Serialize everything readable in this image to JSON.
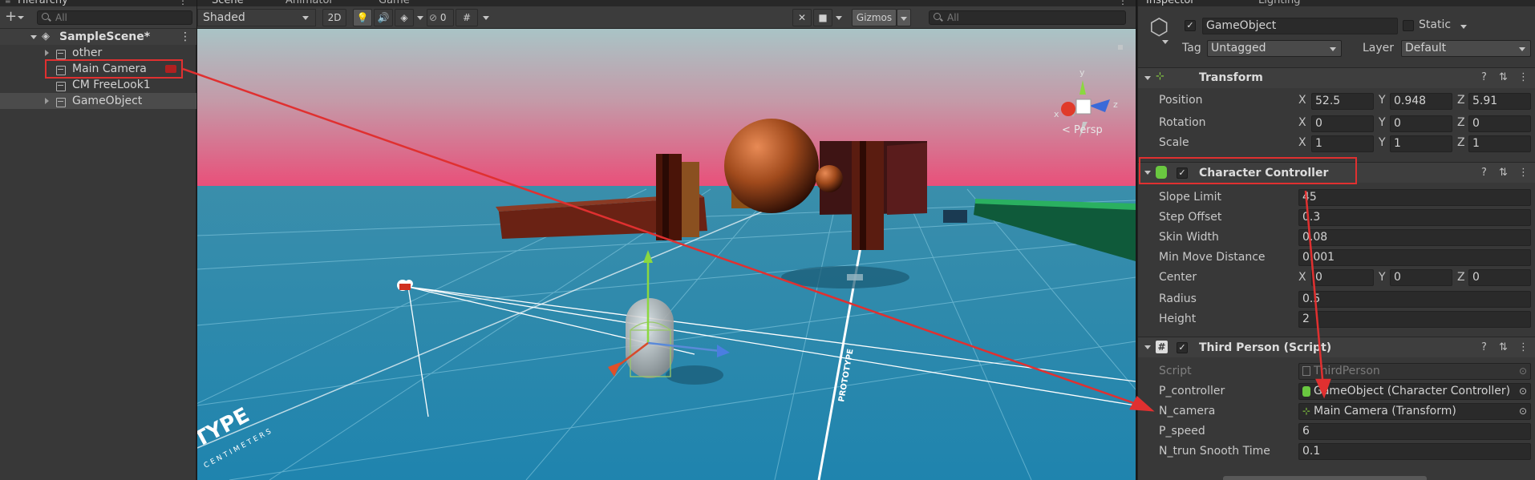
{
  "hierarchy": {
    "tab_label": "Hierarchy",
    "search_placeholder": "All",
    "scene_name": "SampleScene*",
    "items": [
      {
        "label": "other"
      },
      {
        "label": "Main Camera"
      },
      {
        "label": "CM FreeLook1"
      },
      {
        "label": "GameObject"
      }
    ]
  },
  "scene_tabs": {
    "scene": "Scene",
    "animator": "Animator",
    "game": "Game"
  },
  "scene_toolbar": {
    "shading_mode": "Shaded",
    "mode_2d": "2D",
    "hidden_count": "0",
    "gizmos_label": "Gizmos",
    "search_placeholder": "All"
  },
  "scene_view": {
    "persp_label": "< Persp",
    "gizmo_axes": {
      "y": "y",
      "x": "x",
      "z": "z"
    },
    "floor_text": [
      "TYPE",
      "CENTIMETERS",
      "PROTOTYPE"
    ]
  },
  "inspector": {
    "tabs": {
      "inspector": "Inspector",
      "lighting": "Lighting"
    },
    "object_name": "GameObject",
    "static_label": "Static",
    "tag_label": "Tag",
    "tag_value": "Untagged",
    "layer_label": "Layer",
    "layer_value": "Default",
    "transform": {
      "title": "Transform",
      "position": {
        "label": "Position",
        "x": "52.5",
        "y": "0.948",
        "z": "5.91"
      },
      "rotation": {
        "label": "Rotation",
        "x": "0",
        "y": "0",
        "z": "0"
      },
      "scale": {
        "label": "Scale",
        "x": "1",
        "y": "1",
        "z": "1"
      }
    },
    "character_controller": {
      "title": "Character Controller",
      "slope_limit": {
        "label": "Slope Limit",
        "value": "45"
      },
      "step_offset": {
        "label": "Step Offset",
        "value": "0.3"
      },
      "skin_width": {
        "label": "Skin Width",
        "value": "0.08"
      },
      "min_move_distance": {
        "label": "Min Move Distance",
        "value": "0.001"
      },
      "center": {
        "label": "Center",
        "x": "0",
        "y": "0",
        "z": "0"
      },
      "radius": {
        "label": "Radius",
        "value": "0.5"
      },
      "height": {
        "label": "Height",
        "value": "2"
      }
    },
    "third_person": {
      "title": "Third Person (Script)",
      "script": {
        "label": "Script",
        "value": "ThirdPerson"
      },
      "p_controller": {
        "label": "P_controller",
        "value": "GameObject (Character Controller)"
      },
      "n_camera": {
        "label": "N_camera",
        "value": "Main Camera (Transform)"
      },
      "p_speed": {
        "label": "P_speed",
        "value": "6"
      },
      "n_trun": {
        "label": "N_trun Snooth Time",
        "value": "0.1"
      }
    },
    "axis_labels": {
      "x": "X",
      "y": "Y",
      "z": "Z"
    }
  },
  "colors": {
    "annotation_red": "#e03030",
    "sky_top": "#9fb8c0",
    "sky_horizon": "#e8507a",
    "ground": "#2a8ab0"
  }
}
